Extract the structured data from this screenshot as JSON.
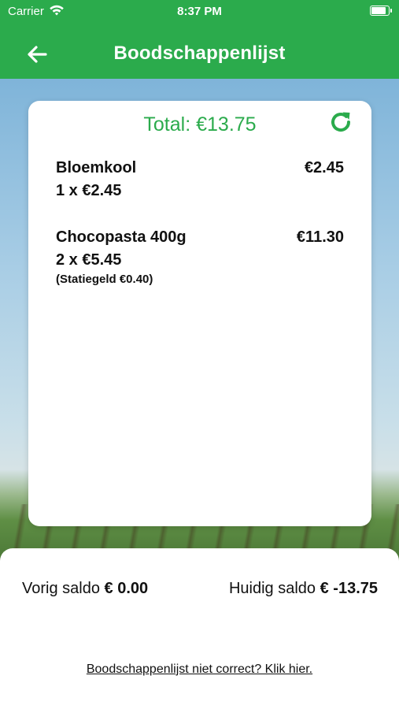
{
  "status_bar": {
    "carrier": "Carrier",
    "time": "8:37 PM"
  },
  "nav": {
    "title": "Boodschappenlijst",
    "back_icon": "arrow-left-icon"
  },
  "card": {
    "total_label": "Total: €13.75",
    "refresh_icon": "refresh-icon",
    "items": [
      {
        "name": "Bloemkool",
        "price": "€2.45",
        "quantity": "1 x €2.45",
        "deposit": ""
      },
      {
        "name": "Chocopasta 400g",
        "price": "€11.30",
        "quantity": "2 x €5.45",
        "deposit": "(Statiegeld €0.40)"
      }
    ]
  },
  "balance": {
    "previous_label": "Vorig saldo",
    "previous_value": "€ 0.00",
    "current_label": "Huidig saldo",
    "current_value": "€ -13.75"
  },
  "report_link": "Boodschappenlijst niet correct? Klik hier.",
  "colors": {
    "primary_green": "#2bab4c",
    "text": "#111111",
    "card": "#ffffff"
  }
}
